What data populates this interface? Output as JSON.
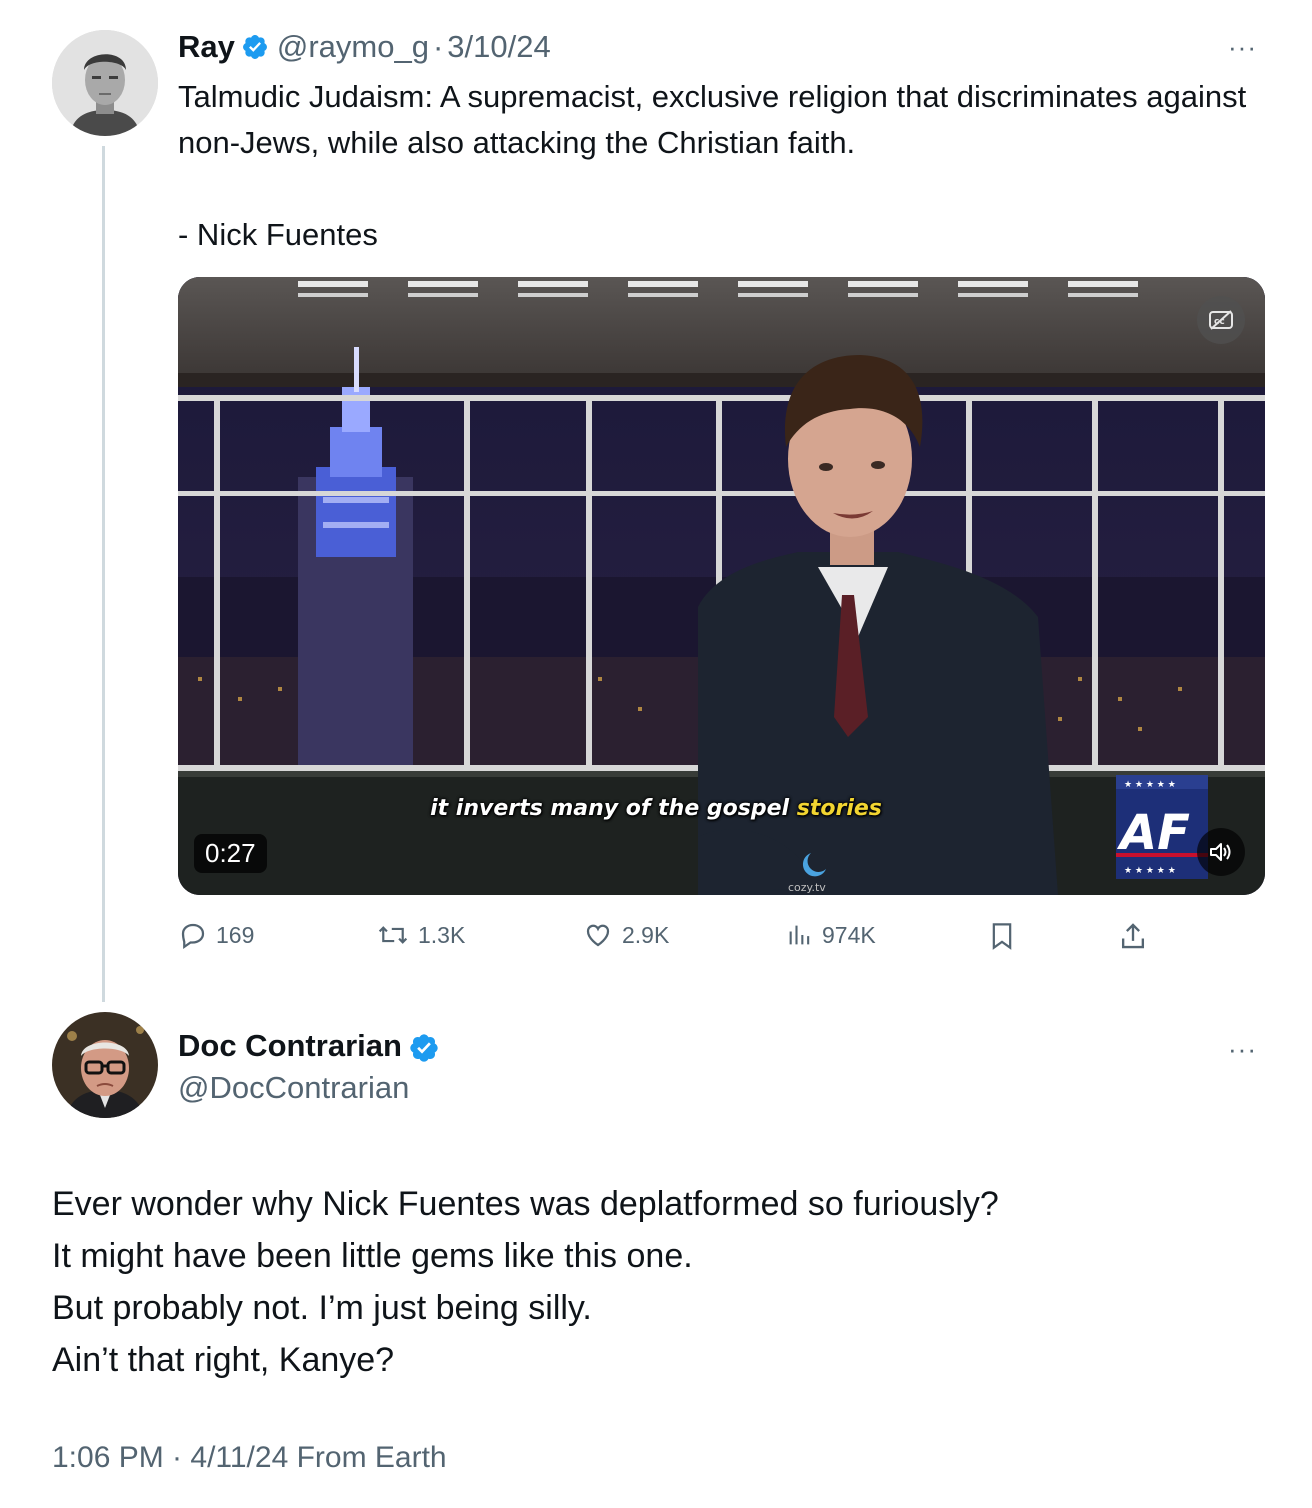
{
  "quoted_tweet": {
    "author_name": "Ray",
    "handle": "@raymo_g",
    "separator": "·",
    "date": "3/10/24",
    "text_line": "Talmudic Judaism: A supremacist, exclusive religion that discriminates against non-Jews, while also attacking the Christian faith.",
    "attribution": "- Nick Fuentes",
    "video": {
      "duration": "0:27",
      "subtitle_main": "it inverts many of the gospel",
      "subtitle_highlight": "stories",
      "watermark": "cozy.tv",
      "logo": "AF"
    },
    "stats": {
      "replies": "169",
      "reposts": "1.3K",
      "likes": "2.9K",
      "views": "974K"
    },
    "icons": {
      "verified": "verified-badge-icon",
      "reply": "reply-icon",
      "repost": "repost-icon",
      "like": "heart-icon",
      "views": "views-chart-icon",
      "bookmark": "bookmark-icon",
      "share": "share-icon"
    }
  },
  "main_tweet": {
    "author_name": "Doc Contrarian",
    "handle": "@DocContrarian",
    "lines": [
      "Ever wonder why Nick Fuentes was deplatformed so furiously?",
      "It might have been little gems like this one.",
      "But probably not. I’m just being silly.",
      "Ain’t that right, Kanye?"
    ],
    "meta": "1:06 PM · 4/11/24 From Earth"
  },
  "more_label": "···",
  "colors": {
    "verified_blue": "#1d9bf0",
    "secondary_text": "#536471",
    "primary_text": "#0f1419",
    "thread_line": "#cfd9de"
  }
}
